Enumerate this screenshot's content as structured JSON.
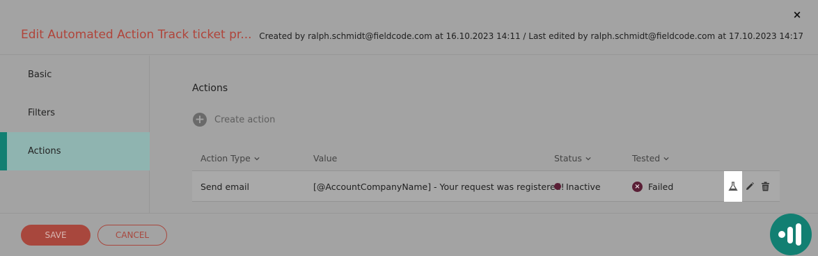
{
  "header": {
    "title": "Edit Automated Action Track ticket pr...",
    "meta": "Created by ralph.schmidt@fieldcode.com at 16.10.2023 14:11 / Last edited by ralph.schmidt@fieldcode.com at 17.10.2023 14:17",
    "close_label": "×"
  },
  "sidebar": {
    "items": [
      {
        "label": "Basic"
      },
      {
        "label": "Filters"
      },
      {
        "label": "Actions",
        "active": true
      }
    ]
  },
  "main": {
    "section_title": "Actions",
    "create_action_label": "Create action",
    "table": {
      "columns": [
        "Action Type",
        "Value",
        "Status",
        "Tested"
      ],
      "rows": [
        {
          "action_type": "Send email",
          "value": "[@AccountCompanyName] - Your request was registered!",
          "status": "Inactive",
          "tested": "Failed"
        }
      ]
    }
  },
  "footer": {
    "save_label": "SAVE",
    "cancel_label": "CANCEL"
  },
  "colors": {
    "accent": "#127f72",
    "brand_red": "#b0443a",
    "status_dark": "#5a1f36"
  },
  "icons": {
    "close": "close-icon",
    "plus": "plus-circle-icon",
    "test": "flask-icon",
    "edit": "pencil-icon",
    "delete": "trash-icon",
    "fab": "app-logo-icon"
  }
}
